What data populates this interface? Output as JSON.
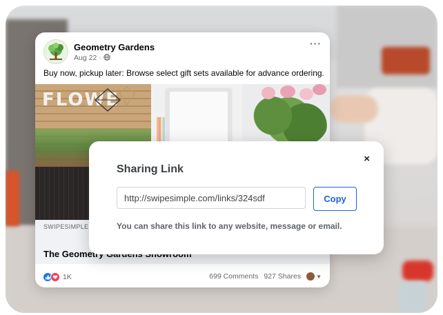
{
  "post": {
    "page_name": "Geometry Gardens",
    "date": "Aug 22",
    "separator": "·",
    "globe_icon": "globe-icon",
    "more_label": "···",
    "text": "Buy now, pickup later: Browse select gift sets available for advance ordering.",
    "image_sign_text": "FLOWE",
    "link_domain": "SWIPESIMPLE.CO",
    "link_title": "The Geometry Gardens Showroom",
    "reaction_count": "1K",
    "comments": "699 Comments",
    "shares": "927 Shares"
  },
  "dialog": {
    "title": "Sharing Link",
    "close_label": "×",
    "url_value": "http://swipesimple.com/links/324sdf",
    "copy_label": "Copy",
    "hint": "You can share this link to any website, message or email."
  },
  "colors": {
    "accent": "#1a66c9",
    "like_blue": "#1877f2",
    "love_red": "#f33e58"
  }
}
